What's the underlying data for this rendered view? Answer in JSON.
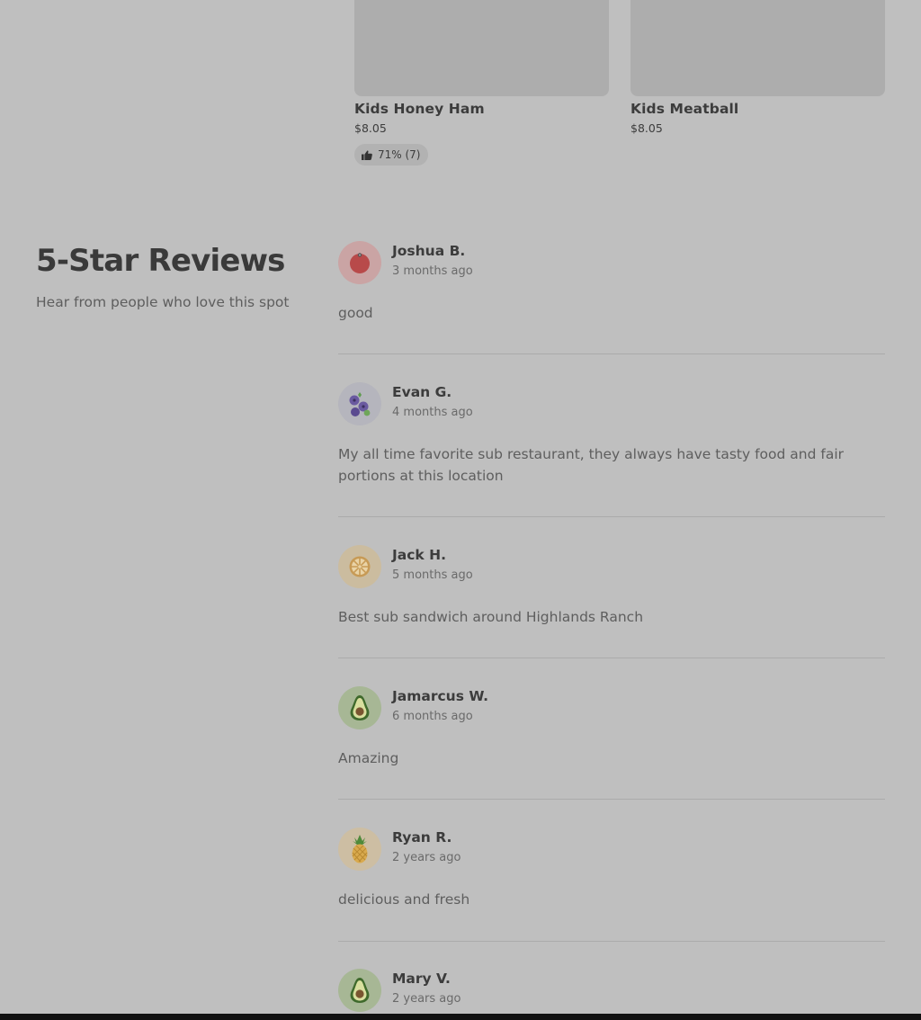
{
  "menu_items": [
    {
      "name": "Kids Honey Ham",
      "price": "$8.05",
      "rating": "71% (7)",
      "rating_icon": "thumbs-up-icon"
    },
    {
      "name": "Kids Meatball",
      "price": "$8.05"
    }
  ],
  "reviews_section": {
    "title": "5-Star Reviews",
    "subtitle": "Hear from people who love this spot"
  },
  "reviews": [
    {
      "name": "Joshua B.",
      "date": "3 months ago",
      "text": "good",
      "avatar": "tomato-icon",
      "avatar_bg": "#caa4a4"
    },
    {
      "name": "Evan G.",
      "date": "4 months ago",
      "text": "My all time favorite sub restaurant, they always have tasty food and fair portions at this location",
      "avatar": "blueberry-icon",
      "avatar_bg": "#b5b5bd"
    },
    {
      "name": "Jack H.",
      "date": "5 months ago",
      "text": "Best sub sandwich around Highlands Ranch",
      "avatar": "orange-slice-icon",
      "avatar_bg": "#cbbc9f"
    },
    {
      "name": "Jamarcus W.",
      "date": "6 months ago",
      "text": "Amazing",
      "avatar": "avocado-icon",
      "avatar_bg": "#a7b795"
    },
    {
      "name": "Ryan R.",
      "date": "2 years ago",
      "text": "delicious and fresh",
      "avatar": "pineapple-icon",
      "avatar_bg": "#cdbea3"
    },
    {
      "name": "Mary V.",
      "date": "2 years ago",
      "text": "",
      "avatar": "avocado-icon",
      "avatar_bg": "#a7b795"
    }
  ]
}
